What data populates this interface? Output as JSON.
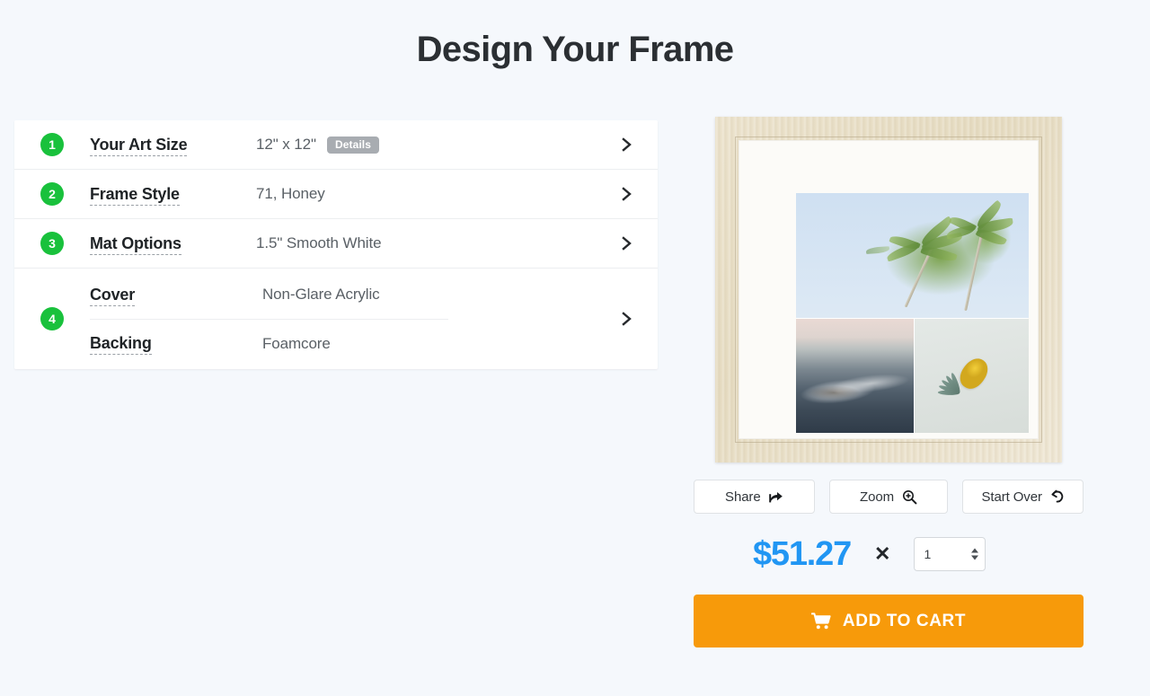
{
  "page": {
    "title": "Design Your Frame",
    "background_color": "#f5f8fc"
  },
  "configurator": {
    "steps": [
      {
        "number": "1",
        "label": "Your Art Size",
        "value": "12\" x 12\"",
        "badge": "Details",
        "chevron_icon": "chevron-right-icon"
      },
      {
        "number": "2",
        "label": "Frame Style",
        "value": "71, Honey",
        "chevron_icon": "chevron-right-icon"
      },
      {
        "number": "3",
        "label": "Mat Options",
        "value": "1.5\" Smooth White",
        "chevron_icon": "chevron-right-icon"
      },
      {
        "number": "4",
        "label_cover": "Cover",
        "value_cover": "Non-Glare Acrylic",
        "label_backing": "Backing",
        "value_backing": "Foamcore",
        "chevron_icon": "chevron-right-icon"
      }
    ],
    "accent_color": "#19c13c",
    "badge_color": "#a8acb1"
  },
  "preview": {
    "frame_color_name": "Honey",
    "frame_hex": "#e8dfc7",
    "mat_hex": "#fcfbf8",
    "collage": [
      {
        "name": "palm-trees-photo"
      },
      {
        "name": "ocean-wave-photo"
      },
      {
        "name": "pineapple-on-sand-photo"
      }
    ]
  },
  "actions": {
    "share": {
      "label": "Share",
      "icon": "share-icon"
    },
    "zoom": {
      "label": "Zoom",
      "icon": "magnifier-plus-icon"
    },
    "start_over": {
      "label": "Start Over",
      "icon": "undo-arrow-icon"
    }
  },
  "purchase": {
    "price": "$51.27",
    "price_color": "#2196f3",
    "multiply_symbol": "✕",
    "quantity": "1",
    "add_to_cart_label": "ADD TO CART",
    "cart_icon": "shopping-cart-icon",
    "cart_button_color": "#f79a0a"
  }
}
